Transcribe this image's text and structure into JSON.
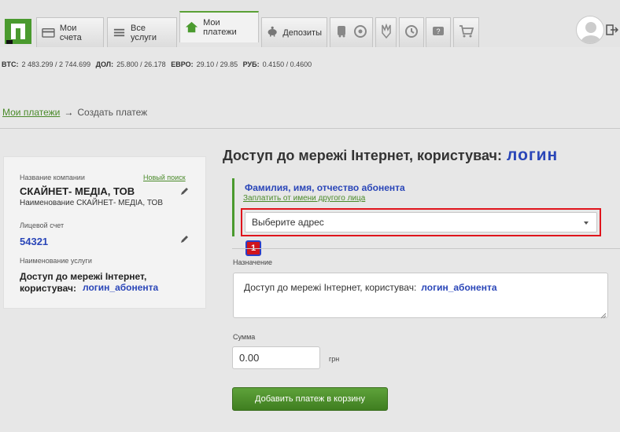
{
  "nav": {
    "tabs": [
      {
        "label": "Мои счета",
        "icon": "card-icon"
      },
      {
        "label": "Все услуги",
        "icon": "list-icon"
      },
      {
        "label": "Мои платежи",
        "icon": "home-icon",
        "active": true
      },
      {
        "label": "Депозиты",
        "icon": "piggy-bank-icon"
      }
    ],
    "icon_tabs": [
      "train-icon",
      "football-icon",
      "trident-icon",
      "history-icon",
      "help-icon",
      "cart-icon"
    ]
  },
  "rates": [
    {
      "label": "BTC:",
      "value": "2 483.299 / 2 744.699"
    },
    {
      "label": "ДОЛ:",
      "value": "25.800 / 26.178"
    },
    {
      "label": "ЕВРО:",
      "value": "29.10 / 29.85"
    },
    {
      "label": "РУБ:",
      "value": "0.4150 / 0.4600"
    }
  ],
  "breadcrumb": {
    "link": "Мои платежи",
    "arrow": "→",
    "current": "Создать платеж"
  },
  "card": {
    "company_label": "Название компании",
    "new_search": "Новый поиск",
    "company_name": "СКАЙНЕТ- МЕДІА, ТОВ",
    "company_full": "Наименование СКАЙНЕТ- МЕДІА, ТОВ",
    "account_label": "Лицевой счет",
    "account_value": "54321",
    "service_label": "Наименование услуги",
    "service_line1": "Доступ до мережі Інтернет,",
    "service_line2": "користувач:",
    "service_login": "логин_абонента"
  },
  "form": {
    "title": "Доступ до мережі Інтернет, користувач:",
    "title_login": "логин",
    "payer_name": "Фамилия, имя, отчество абонента",
    "pay_for_other": "Заплатить от имени другого лица",
    "address_select": "Выберите адрес",
    "annotation_number": "1",
    "purpose_label": "Назначение",
    "purpose_text": "Доступ до мережі Інтернет, користувач:",
    "purpose_login": "логин_абонента",
    "sum_label": "Сумма",
    "sum_value": "0.00",
    "currency": "грн",
    "submit": "Добавить платеж в корзину"
  },
  "colors": {
    "accent": "#4a9a2e",
    "highlight": "#e0141c",
    "login_blue": "#2a46b8"
  }
}
